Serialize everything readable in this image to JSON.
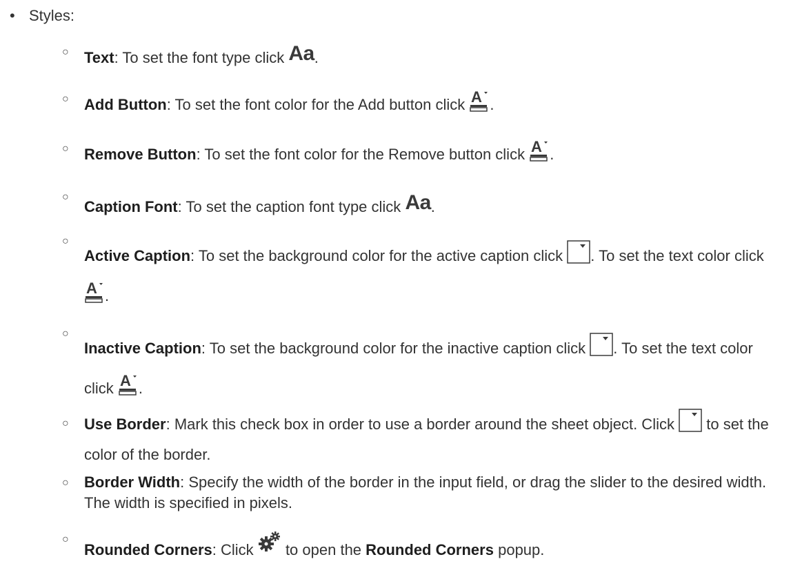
{
  "styles_heading": "Styles:",
  "items": [
    {
      "term": "Text",
      "text_before": ": To set the font type click",
      "text_after": "."
    },
    {
      "term": "Add Button",
      "text_before": ": To set the font color for the Add button click",
      "text_after": "."
    },
    {
      "term": "Remove Button",
      "text_before": ": To set the font color for the Remove button click",
      "text_after": "."
    },
    {
      "term": "Caption Font",
      "text_before": ": To set the caption font type click",
      "text_after": "."
    },
    {
      "term": "Active Caption",
      "text_before": ": To set the background color for the active caption click",
      "text_mid": ". To set the text color click",
      "text_after": "."
    },
    {
      "term": "Inactive Caption",
      "text_before": ": To set the background color for the inactive caption click",
      "text_mid": ". To set the text color click",
      "text_after": "."
    },
    {
      "term": "Use Border",
      "text_before": ": Mark this check box in order to use a border around the sheet object. Click",
      "text_after": "to set the color of the border."
    },
    {
      "term": "Border Width",
      "text_before": ": Specify the width of the border in the input field, or drag the slider to the desired width. The width is specified in pixels."
    },
    {
      "term": "Rounded Corners",
      "text_before": ": Click",
      "text_mid": "to open the",
      "term2": "Rounded Corners",
      "text_after": "popup."
    }
  ],
  "icon_font_label": "Aa",
  "icons": {
    "font_type": "font-type-icon",
    "font_color": "font-color-icon",
    "color_picker": "color-dropdown-icon",
    "settings": "gears-icon"
  }
}
